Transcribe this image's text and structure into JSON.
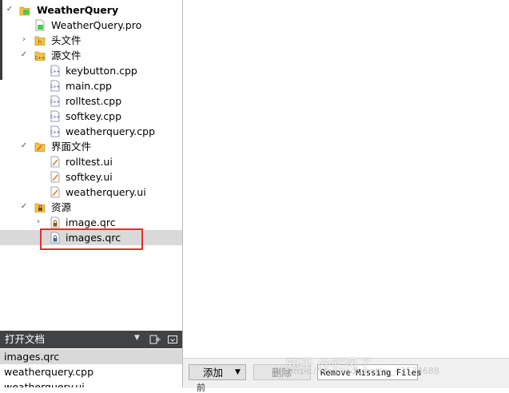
{
  "project_tree": {
    "root": "WeatherQuery",
    "items": [
      {
        "label": "WeatherQuery.pro"
      },
      {
        "label": "头文件"
      },
      {
        "label": "源文件"
      },
      {
        "label": "keybutton.cpp"
      },
      {
        "label": "main.cpp"
      },
      {
        "label": "rolltest.cpp"
      },
      {
        "label": "softkey.cpp"
      },
      {
        "label": "weatherquery.cpp"
      },
      {
        "label": "界面文件"
      },
      {
        "label": "rolltest.ui"
      },
      {
        "label": "softkey.ui"
      },
      {
        "label": "weatherquery.ui"
      },
      {
        "label": "资源"
      },
      {
        "label": "image.qrc"
      },
      {
        "label": "images.qrc"
      }
    ]
  },
  "open_documents": {
    "title": "打开文档",
    "items": [
      "images.qrc",
      "weatherquery.cpp",
      "weatherquery.ui"
    ]
  },
  "toolbar": {
    "add_label": "添加",
    "delete_label": "删除",
    "remove_missing_label": "Remove Missing Files"
  },
  "bottom_cut_text": "前",
  "watermark": {
    "text": "知乎 @起风了",
    "url": "https://blog.csdn.net/m_43574688"
  },
  "colors": {
    "highlight": "#e03030",
    "selection": "#d9d9d9",
    "panel_header": "#404244",
    "qt_green": "#41cd52"
  },
  "icons": [
    "qt-project-icon",
    "pro-file-icon",
    "folder-icon",
    "cpp-file-icon",
    "ui-file-icon",
    "qrc-file-icon"
  ]
}
